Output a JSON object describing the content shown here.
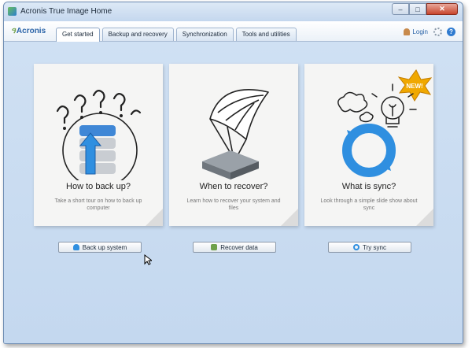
{
  "window": {
    "title": "Acronis True Image Home"
  },
  "toolbar": {
    "logo": "Acronis",
    "tabs": [
      {
        "label": "Get started",
        "active": true
      },
      {
        "label": "Backup and recovery",
        "active": false
      },
      {
        "label": "Synchronization",
        "active": false
      },
      {
        "label": "Tools and utilities",
        "active": false
      }
    ],
    "login_label": "Login"
  },
  "cards": [
    {
      "title": "How to back up?",
      "description": "Take a short tour on how to back up computer",
      "button_label": "Back up system"
    },
    {
      "title": "When to recover?",
      "description": "Learn how to recover your system and files",
      "button_label": "Recover data"
    },
    {
      "title": "What is sync?",
      "description": "Look through a simple slide show about sync",
      "button_label": "Try sync",
      "badge": "NEW!"
    }
  ],
  "colors": {
    "accent": "#2b64a8",
    "background": "#c6daf0",
    "sync_blue": "#2f8fe0",
    "new_badge": "#f0a800"
  }
}
